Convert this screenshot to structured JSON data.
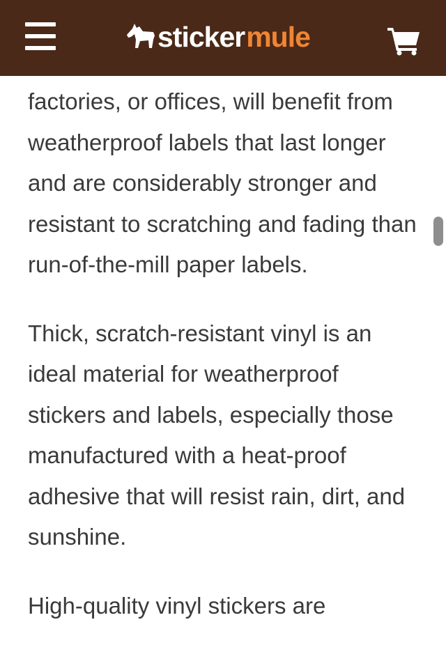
{
  "header": {
    "logo_part1": "sticker",
    "logo_part2": "mule",
    "colors": {
      "background": "#4a2918",
      "accent": "#f08534",
      "text": "#ffffff"
    },
    "icons": [
      "menu-icon",
      "mule-icon",
      "cart-icon"
    ]
  },
  "article": {
    "paragraphs": [
      "factories, or offices, will benefit from weatherproof labels that last longer and are considerably stronger and resistant to scratching and fading than run-of-the-mill paper labels.",
      "Thick, scratch-resistant vinyl is an ideal material for weatherproof stickers and labels, especially those manufactured with a heat-proof adhesive that will resist rain, dirt, and sunshine.",
      "High-quality vinyl stickers are"
    ]
  }
}
